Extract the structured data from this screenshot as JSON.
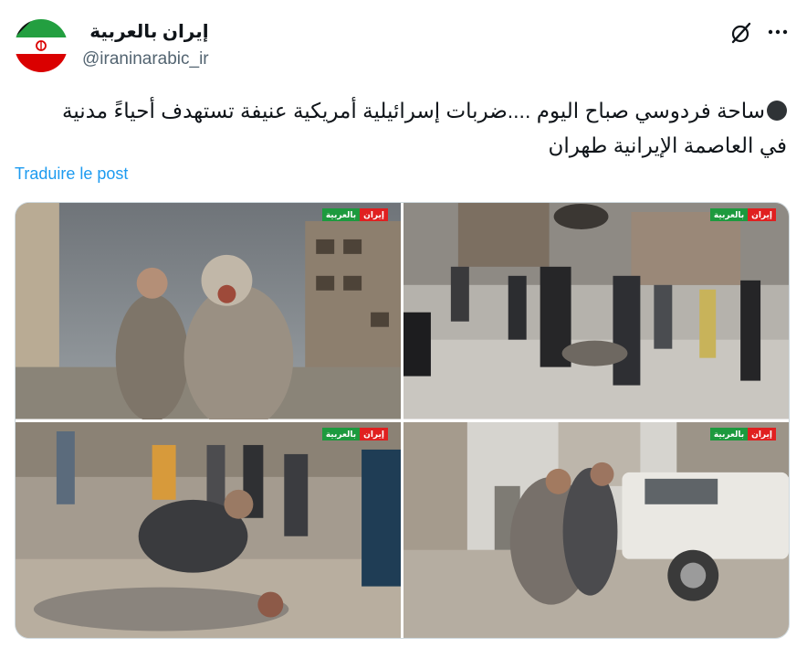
{
  "account": {
    "display_name": "إيران بالعربية",
    "handle": "@iraninarabic_ir",
    "avatar_icon": "iran-flag-black-ribbon-icon"
  },
  "actions": {
    "grok_icon": "grok-slash-circle-icon",
    "more_icon": "more-dots-icon"
  },
  "post": {
    "emoji": "black-circle",
    "text": "ساحة فردوسي صباح اليوم ....ضربات إسرائيلية أمريكية عنيفة تستهدف أحياءً مدنية في العاصمة الإيرانية طهران",
    "translate_label": "Traduire le post"
  },
  "media": {
    "watermark_left": "إيران",
    "watermark_right": "بالعربية",
    "photos": [
      {
        "id": "photo-1",
        "subject": "injured man covered in dust with another man behind, damaged building"
      },
      {
        "id": "photo-2",
        "subject": "men carrying injured person through debris-filled street, smoke in background"
      },
      {
        "id": "photo-3",
        "subject": "man kneeling beside injured man lying on rubble, rescuers behind"
      },
      {
        "id": "photo-4",
        "subject": "man supporting injured man walking past damaged white pickup truck"
      }
    ]
  },
  "colors": {
    "text_primary": "#0f1419",
    "text_secondary": "#536471",
    "link": "#1d9bf0",
    "border": "#cfd9de",
    "flag_green": "#239f40",
    "flag_red": "#da0000"
  }
}
